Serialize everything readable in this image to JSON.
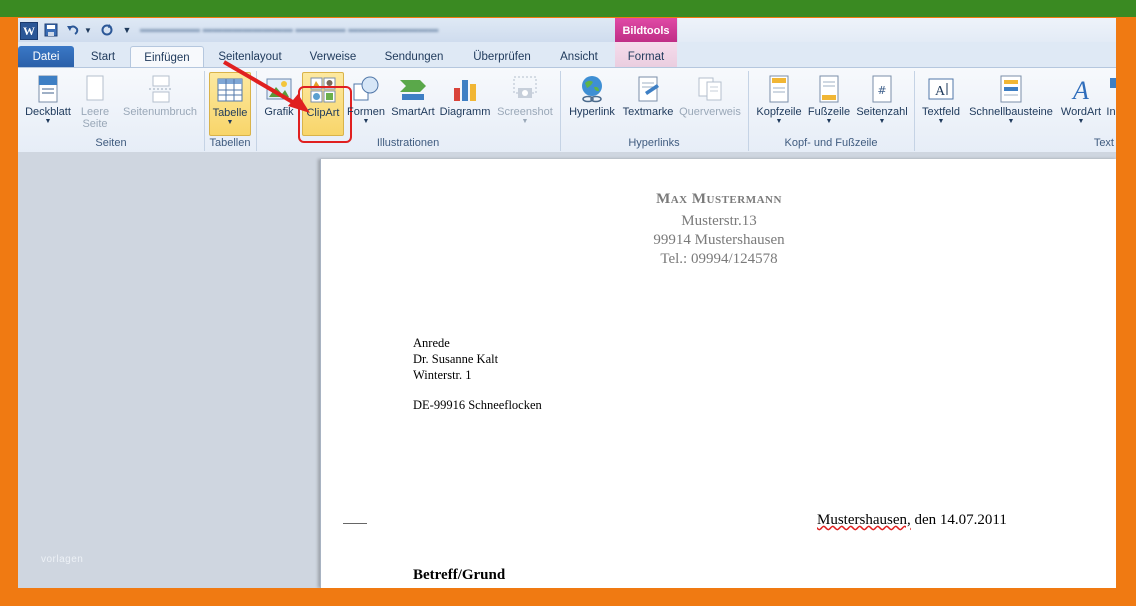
{
  "titlebar": {
    "app_icon": "W",
    "icons": [
      "word-icon",
      "save-icon",
      "undo-icon",
      "redo-icon",
      "customize-quick-access-icon"
    ]
  },
  "context_tab": {
    "label": "Bildtools"
  },
  "tabs": {
    "datei": "Datei",
    "start": "Start",
    "einfuegen": "Einfügen",
    "seitenlayout": "Seitenlayout",
    "verweise": "Verweise",
    "sendungen": "Sendungen",
    "ueberpruefen": "Überprüfen",
    "ansicht": "Ansicht",
    "format": "Format"
  },
  "ribbon": {
    "deckblatt": "Deckblatt",
    "leere_seite": [
      "Leere",
      "Seite"
    ],
    "seitenumbruch": "Seitenumbruch",
    "tabelle": "Tabelle",
    "grafik": "Grafik",
    "clipart": "ClipArt",
    "formen": "Formen",
    "smartart": "SmartArt",
    "diagramm": "Diagramm",
    "screenshot": "Screenshot",
    "hyperlink": "Hyperlink",
    "textmarke": "Textmarke",
    "querverweis": "Querverweis",
    "kopfzeile": "Kopfzeile",
    "fusszeile": "Fußzeile",
    "seitenzahl": "Seitenzahl",
    "textfeld": "Textfeld",
    "schnellbausteine": "Schnellbausteine",
    "wordart": "WordArt",
    "more": "In",
    "groups": {
      "seiten": "Seiten",
      "tabellen": "Tabellen",
      "illustrationen": "Illustrationen",
      "hyperlinks": "Hyperlinks",
      "kopf_fuss": "Kopf- und Fußzeile",
      "text": "Text"
    }
  },
  "colors": {
    "frame": "#f07a12",
    "frame_top": "#3a8a22",
    "highlight_red": "#e02020",
    "bildtools_pink": "#d03c96",
    "datei_blue": "#2b6cb8"
  },
  "sidebar": {
    "watermark": "vorlagen"
  },
  "document": {
    "sender": {
      "name": "Max Mustermann",
      "street": "Musterstr.13",
      "city": "99914 Mustershausen",
      "tel": "Tel.: 09994/124578"
    },
    "recipient": {
      "line1": "Anrede",
      "line2": "Dr. Susanne Kalt",
      "line3": "Winterstr. 1",
      "line4": "DE-99916 Schneeflocken"
    },
    "date": {
      "city": "Mustershausen,",
      "rest": " den 14.07.2011"
    },
    "subject": "Betreff/Grund"
  }
}
